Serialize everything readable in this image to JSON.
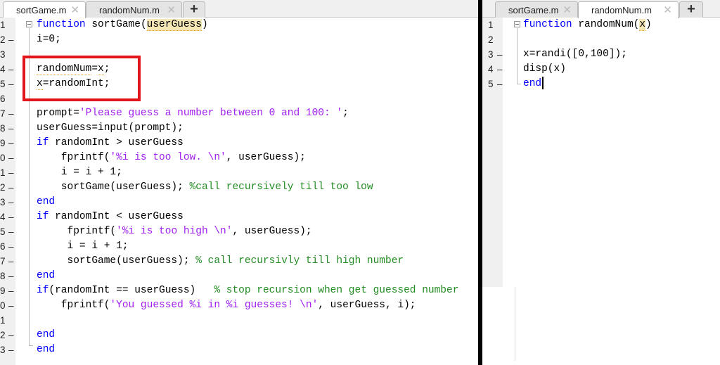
{
  "left": {
    "tabs": [
      {
        "label": "sortGame.m",
        "active": true
      },
      {
        "label": "randomNum.m",
        "active": false
      }
    ],
    "plus": "+",
    "close": "✕",
    "lines": [
      {
        "n": "1",
        "dash": false,
        "t": [
          [
            "kw",
            "function"
          ],
          [
            "tx",
            " sortGame("
          ],
          [
            "hl",
            "userGuess"
          ],
          [
            "tx",
            ")"
          ]
        ]
      },
      {
        "n": "2",
        "dash": true,
        "t": [
          [
            "tx",
            "i=0;"
          ]
        ]
      },
      {
        "n": "3",
        "dash": false,
        "t": []
      },
      {
        "n": "4",
        "dash": true,
        "t": [
          [
            "warn",
            "randomNum"
          ],
          [
            "tx",
            "="
          ],
          [
            "warn",
            "x"
          ],
          [
            "tx",
            ";"
          ]
        ]
      },
      {
        "n": "5",
        "dash": true,
        "t": [
          [
            "warn",
            "x"
          ],
          [
            "tx",
            "=randomInt;"
          ]
        ]
      },
      {
        "n": "6",
        "dash": false,
        "t": []
      },
      {
        "n": "7",
        "dash": true,
        "t": [
          [
            "tx",
            "prompt="
          ],
          [
            "str",
            "'Please guess a number between 0 and 100: '"
          ],
          [
            "tx",
            ";"
          ]
        ]
      },
      {
        "n": "8",
        "dash": true,
        "t": [
          [
            "tx",
            "userGuess=input(prompt);"
          ]
        ]
      },
      {
        "n": "9",
        "dash": true,
        "t": [
          [
            "kw",
            "if"
          ],
          [
            "tx",
            " randomInt > userGuess"
          ]
        ]
      },
      {
        "n": "0",
        "dash": true,
        "t": [
          [
            "tx",
            "    fprintf("
          ],
          [
            "str",
            "'%i is too low. \\n'"
          ],
          [
            "tx",
            ", userGuess);"
          ]
        ]
      },
      {
        "n": "1",
        "dash": true,
        "t": [
          [
            "tx",
            "    i = i + 1;"
          ]
        ]
      },
      {
        "n": "2",
        "dash": true,
        "t": [
          [
            "tx",
            "    sortGame(userGuess); "
          ],
          [
            "cm",
            "%call recursively till too low"
          ]
        ]
      },
      {
        "n": "3",
        "dash": true,
        "t": [
          [
            "kw",
            "end"
          ]
        ]
      },
      {
        "n": "4",
        "dash": true,
        "t": [
          [
            "kw",
            "if"
          ],
          [
            "tx",
            " randomInt < userGuess"
          ]
        ]
      },
      {
        "n": "5",
        "dash": true,
        "t": [
          [
            "tx",
            "     fprintf("
          ],
          [
            "str",
            "'%i is too high \\n'"
          ],
          [
            "tx",
            ", userGuess);"
          ]
        ]
      },
      {
        "n": "6",
        "dash": true,
        "t": [
          [
            "tx",
            "     i = i + 1;"
          ]
        ]
      },
      {
        "n": "7",
        "dash": true,
        "t": [
          [
            "tx",
            "     sortGame(userGuess); "
          ],
          [
            "cm",
            "% call recursivly till high number"
          ]
        ]
      },
      {
        "n": "8",
        "dash": true,
        "t": [
          [
            "kw",
            "end"
          ]
        ]
      },
      {
        "n": "9",
        "dash": true,
        "t": [
          [
            "kw",
            "if"
          ],
          [
            "tx",
            "(randomInt == userGuess)   "
          ],
          [
            "cm",
            "% stop recursion when get guessed number"
          ]
        ]
      },
      {
        "n": "0",
        "dash": true,
        "t": [
          [
            "tx",
            "    fprintf("
          ],
          [
            "str",
            "'You guessed %i in %i guesses! \\n'"
          ],
          [
            "tx",
            ", userGuess, i);"
          ]
        ]
      },
      {
        "n": "1",
        "dash": false,
        "t": []
      },
      {
        "n": "2",
        "dash": true,
        "t": [
          [
            "kw",
            "end"
          ]
        ]
      },
      {
        "n": "3",
        "dash": true,
        "t": [
          [
            "kw",
            "end"
          ]
        ]
      }
    ]
  },
  "right": {
    "tabs": [
      {
        "label": "sortGame.m",
        "active": false
      },
      {
        "label": "randomNum.m",
        "active": true
      }
    ],
    "plus": "+",
    "close": "✕",
    "lines": [
      {
        "n": "1",
        "dash": false,
        "t": [
          [
            "kw",
            "function"
          ],
          [
            "tx",
            " randomNum("
          ],
          [
            "hl",
            "x"
          ],
          [
            "tx",
            ")"
          ]
        ]
      },
      {
        "n": "2",
        "dash": false,
        "t": []
      },
      {
        "n": "3",
        "dash": true,
        "t": [
          [
            "tx",
            "x=randi([0,100]);"
          ]
        ]
      },
      {
        "n": "4",
        "dash": true,
        "t": [
          [
            "tx",
            "disp(x)"
          ]
        ]
      },
      {
        "n": "5",
        "dash": true,
        "t": [
          [
            "kw",
            "end"
          ]
        ]
      }
    ]
  },
  "colors": {
    "keyword": "#0000ff",
    "string": "#a020f0",
    "comment": "#228b22",
    "highlight_box": "#e3151c"
  }
}
